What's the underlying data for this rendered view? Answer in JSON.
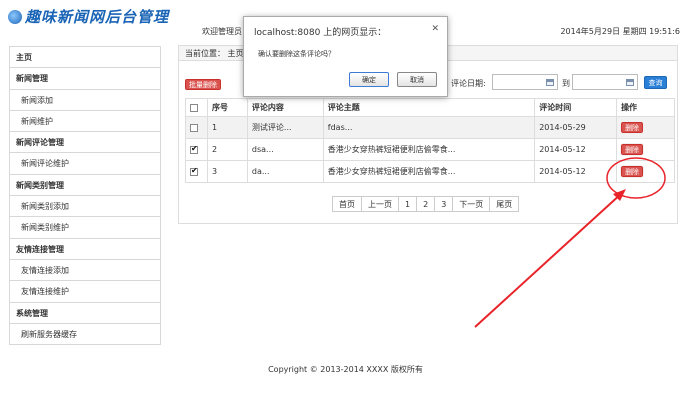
{
  "header": {
    "logo": "趣味新闻网后台管理",
    "welcome": "欢迎管理员",
    "datetime": "2014年5月29日 星期四 19:51:6"
  },
  "sidebar": {
    "items": [
      {
        "label": "主页",
        "type": "group"
      },
      {
        "label": "新闻管理",
        "type": "group"
      },
      {
        "label": "新闻添加",
        "type": "sub"
      },
      {
        "label": "新闻维护",
        "type": "sub"
      },
      {
        "label": "新闻评论管理",
        "type": "group"
      },
      {
        "label": "新闻评论维护",
        "type": "sub"
      },
      {
        "label": "新闻类别管理",
        "type": "group"
      },
      {
        "label": "新闻类别添加",
        "type": "sub"
      },
      {
        "label": "新闻类别维护",
        "type": "sub"
      },
      {
        "label": "友情连接管理",
        "type": "group"
      },
      {
        "label": "友情连接添加",
        "type": "sub"
      },
      {
        "label": "友情连接维护",
        "type": "sub"
      },
      {
        "label": "系统管理",
        "type": "group"
      },
      {
        "label": "刷新服务器缓存",
        "type": "sub"
      }
    ]
  },
  "main": {
    "breadcrumb": "当前位置： 主页",
    "batch_delete": "批量删除",
    "filter_label": "评论日期:",
    "to_label": "到",
    "date_from": "",
    "date_to": "",
    "search_label": "查询",
    "columns": [
      "",
      "序号",
      "评论内容",
      "评论主题",
      "评论时间",
      "操作"
    ],
    "rows": [
      {
        "checked": false,
        "no": "1",
        "content": "测试评论...",
        "topic": "fdas...",
        "time": "2014-05-29",
        "action": "删除"
      },
      {
        "checked": true,
        "no": "2",
        "content": "dsa...",
        "topic": "香港少女穿热裤短裙便利店偷零食...",
        "time": "2014-05-12",
        "action": "删除"
      },
      {
        "checked": true,
        "no": "3",
        "content": "da...",
        "topic": "香港少女穿热裤短裙便利店偷零食...",
        "time": "2014-05-12",
        "action": "删除"
      }
    ],
    "pagination": {
      "first": "首页",
      "prev": "上一页",
      "pages": [
        "1",
        "2",
        "3"
      ],
      "next": "下一页",
      "last": "尾页"
    }
  },
  "dialog": {
    "title": "localhost:8080 上的网页显示：",
    "close": "✕",
    "message": "确认要删除这条评论吗？",
    "ok": "确定",
    "cancel": "取消"
  },
  "footer": {
    "copyright": "Copyright © 2013-2014 XXXX 版权所有"
  },
  "colors": {
    "annotation": "#e8242a",
    "primary": "#2a7fd6",
    "danger": "#d9534f"
  }
}
